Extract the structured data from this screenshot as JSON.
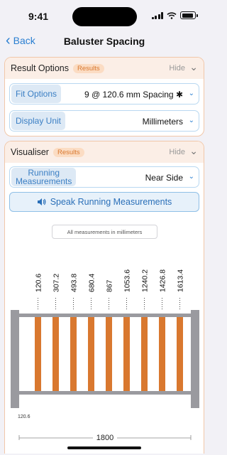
{
  "status_bar": {
    "time": "9:41"
  },
  "nav": {
    "back_label": "Back",
    "title": "Baluster Spacing"
  },
  "result_options": {
    "title": "Result Options",
    "badge": "Results",
    "hide_label": "Hide",
    "fit_options": {
      "label": "Fit Options",
      "value": "9 @ 120.6 mm Spacing ✱"
    },
    "display_unit": {
      "label": "Display Unit",
      "value": "Millimeters"
    }
  },
  "visualiser": {
    "title": "Visualiser",
    "badge": "Results",
    "hide_label": "Hide",
    "running_measurements": {
      "label_line1": "Running",
      "label_line2": "Measurements",
      "value": "Near Side"
    },
    "speak_button": "Speak Running Measurements",
    "note": "All measurements in millimeters",
    "running_values": [
      "120.6",
      "307.2",
      "493.8",
      "680.4",
      "867",
      "1053.6",
      "1240.2",
      "1426.8",
      "1613.4"
    ],
    "baluster_count": 9,
    "gap_label": "120.6",
    "total_length": "1800"
  },
  "colors": {
    "accent_blue": "#2a7fd1",
    "baluster_orange": "#d9782f",
    "post_gray": "#9a9a9f",
    "card_border": "#f1c7a9"
  }
}
